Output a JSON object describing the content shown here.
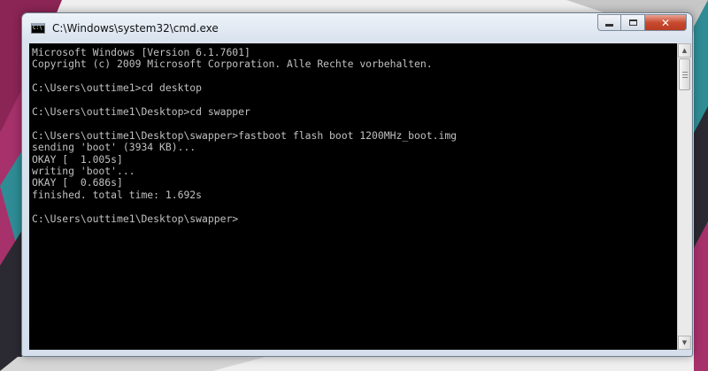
{
  "window": {
    "title": "C:\\Windows\\system32\\cmd.exe",
    "icon": "cmd-console-icon",
    "icon_text": "C:\\",
    "controls": {
      "minimize": "minimize-icon",
      "maximize": "maximize-icon",
      "close": "close-icon",
      "close_glyph": "✕"
    }
  },
  "console": {
    "lines": [
      "Microsoft Windows [Version 6.1.7601]",
      "Copyright (c) 2009 Microsoft Corporation. Alle Rechte vorbehalten.",
      "",
      "C:\\Users\\outtime1>cd desktop",
      "",
      "C:\\Users\\outtime1\\Desktop>cd swapper",
      "",
      "C:\\Users\\outtime1\\Desktop\\swapper>fastboot flash boot 1200MHz_boot.img",
      "sending 'boot' (3934 KB)...",
      "OKAY [  1.005s]",
      "writing 'boot'...",
      "OKAY [  0.686s]",
      "finished. total time: 1.692s",
      "",
      "C:\\Users\\outtime1\\Desktop\\swapper>"
    ],
    "text_color": "#c0c0c0",
    "background": "#000000"
  },
  "scrollbar": {
    "up": "▲",
    "down": "▼"
  },
  "colors": {
    "desktop_magenta": "#a6316b",
    "desktop_teal": "#2f8c95",
    "desktop_dark": "#2b2a33"
  }
}
